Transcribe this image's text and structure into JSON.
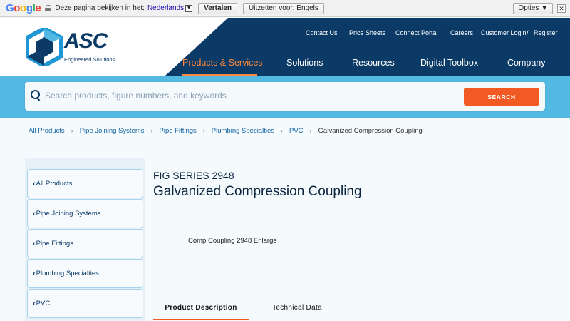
{
  "translate_bar": {
    "logo": "Google",
    "prompt": "Deze pagina bekijken in het:",
    "language": "Nederlands",
    "translate_button": "Vertalen",
    "disable_button": "Uitzetten voor: Engels",
    "options_button": "Opties ▼",
    "close": "✕"
  },
  "header": {
    "logo_text": "ASC",
    "logo_subtitle": "Engineered Solutions",
    "utility_links": [
      "Contact Us",
      "Price Sheets",
      "Connect Portal",
      "Careers",
      "Customer Login",
      "/",
      "Register"
    ],
    "main_nav": [
      "Products & Services",
      "Solutions",
      "Resources",
      "Digital Toolbox",
      "Company"
    ],
    "active_nav": "Products & Services"
  },
  "search": {
    "placeholder": "Search products, figure numbers, and keywords",
    "button_label": "SEARCH"
  },
  "breadcrumb": {
    "links": [
      "All Products",
      "Pipe Joining Systems",
      "Pipe Fittings",
      "Plumbing Specialties",
      "PVC"
    ],
    "separator": "›",
    "current": "Galvanized Compression Coupling"
  },
  "sidebar": {
    "items": [
      "All Products",
      "Pipe Joining Systems",
      "Pipe Fittings",
      "Plumbing Specialties",
      "PVC"
    ]
  },
  "product": {
    "series": "FIG SERIES 2948",
    "title": "Galvanized Compression Coupling",
    "image_caption": "Comp Coupling 2948 Enlarge"
  },
  "tabs": [
    "Product Description",
    "Technical Data"
  ],
  "colors": {
    "navy": "#0b3a66",
    "accent_orange": "#f15a22",
    "search_band": "#54b9e2"
  }
}
